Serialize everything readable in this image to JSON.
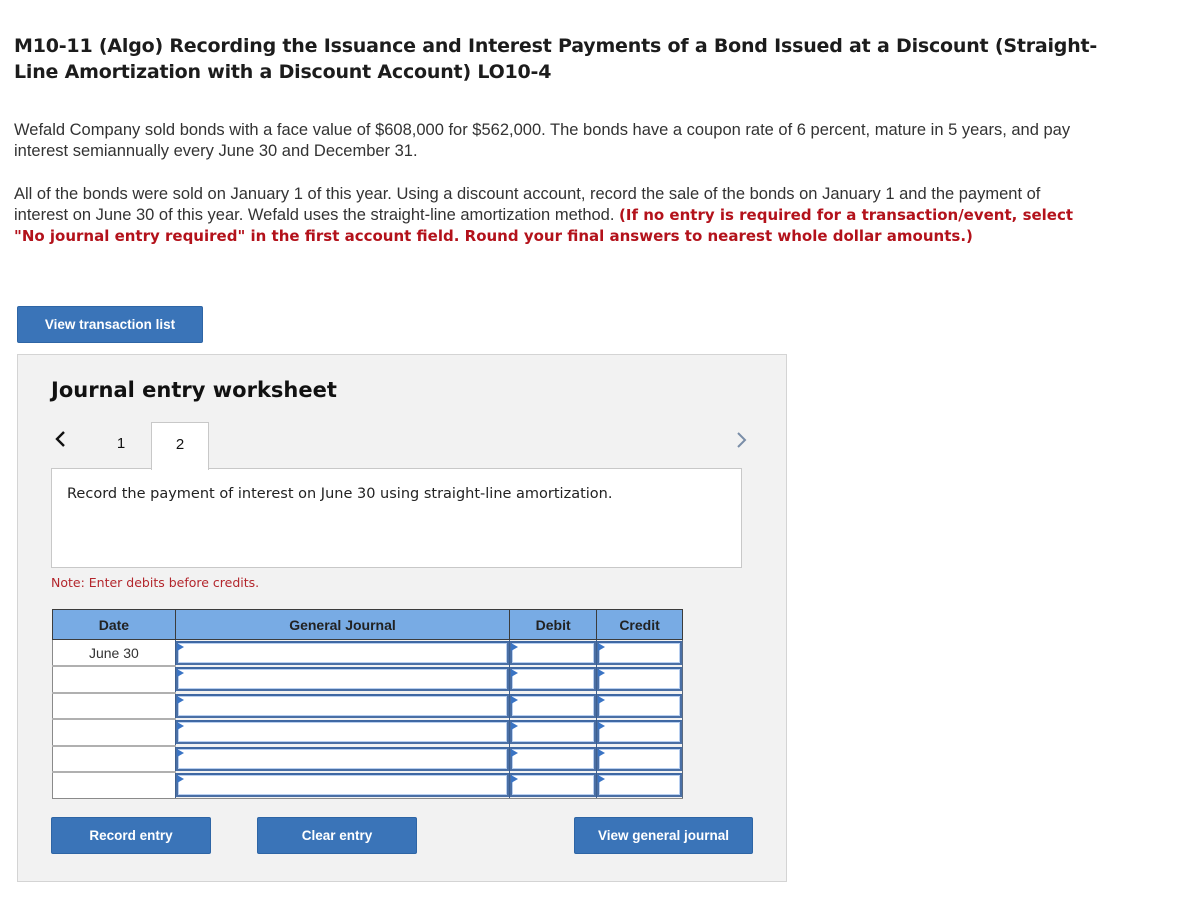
{
  "problem": {
    "title": "M10-11 (Algo) Recording the Issuance and Interest Payments of a Bond Issued at a Discount (Straight-Line Amortization with a Discount Account) LO10-4",
    "paragraph1": "Wefald Company sold bonds with a face value of $608,000 for $562,000. The bonds have a coupon rate of 6 percent, mature in 5 years, and pay interest semiannually every June 30 and December 31.",
    "paragraph2_plain": "All of the bonds were sold on January 1 of this year. Using a discount account, record the sale of the bonds on January 1 and the payment of interest on June 30 of this year. Wefald uses the straight-line amortization method. ",
    "paragraph2_instruction": "(If no entry is required for a transaction/event, select \"No journal entry required\" in the first account field. Round your final answers to nearest whole dollar amounts.)"
  },
  "buttons": {
    "view_transaction_list": "View transaction list",
    "record_entry": "Record entry",
    "clear_entry": "Clear entry",
    "view_general_journal": "View general journal"
  },
  "worksheet": {
    "title": "Journal entry worksheet",
    "tabs": [
      {
        "label": "1",
        "active": false
      },
      {
        "label": "2",
        "active": true
      }
    ],
    "description": "Record the payment of interest on June 30 using straight-line amortization.",
    "note": "Note: Enter debits before credits.",
    "columns": [
      "Date",
      "General Journal",
      "Debit",
      "Credit"
    ],
    "rows": [
      {
        "date": "June 30",
        "account": "",
        "debit": "",
        "credit": ""
      },
      {
        "date": "",
        "account": "",
        "debit": "",
        "credit": ""
      },
      {
        "date": "",
        "account": "",
        "debit": "",
        "credit": ""
      },
      {
        "date": "",
        "account": "",
        "debit": "",
        "credit": ""
      },
      {
        "date": "",
        "account": "",
        "debit": "",
        "credit": ""
      },
      {
        "date": "",
        "account": "",
        "debit": "",
        "credit": ""
      }
    ]
  },
  "icons": {
    "prev": "chevron-left-icon",
    "next": "chevron-right-icon",
    "input_marker": "dropdown-marker-icon"
  },
  "colors": {
    "button_blue": "#3a74b8",
    "header_blue": "#78abe4",
    "instruction_red": "#b3121b"
  }
}
